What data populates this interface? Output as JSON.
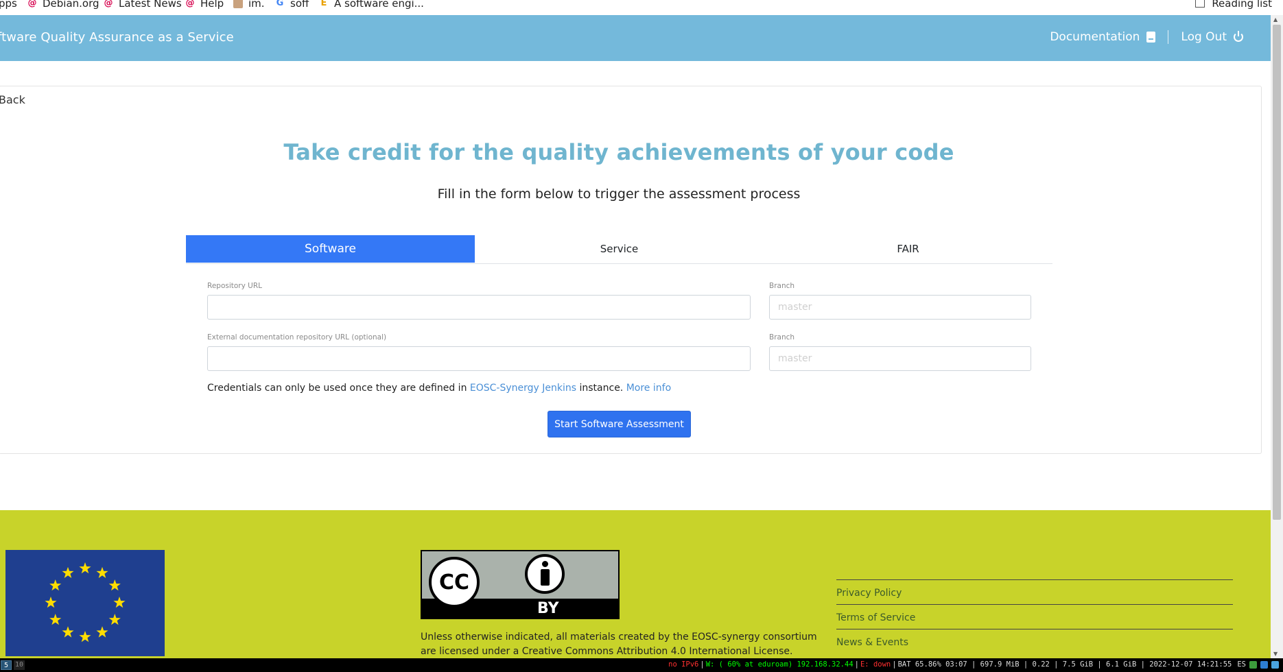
{
  "bookmarks": {
    "items": [
      {
        "label": "pps",
        "icon": ""
      },
      {
        "label": "Debian.org",
        "icon": "debian-swirl-icon"
      },
      {
        "label": "Latest News",
        "icon": "debian-swirl-icon"
      },
      {
        "label": "Help",
        "icon": "debian-swirl-icon"
      },
      {
        "label": "im.",
        "icon": "avatar-face-icon"
      },
      {
        "label": "soff",
        "icon": "google-icon"
      },
      {
        "label": "A software engi...",
        "icon": "etymology-icon"
      }
    ],
    "reading_list": "Reading list"
  },
  "header": {
    "brand": "ftware Quality Assurance as a Service",
    "documentation": "Documentation",
    "logout": "Log Out",
    "color": "#74b9db"
  },
  "main": {
    "back": "Back",
    "title": "Take credit for the quality achievements of your code",
    "subtitle": "Fill in the form below to trigger the assessment process",
    "tabs": [
      {
        "label": "Software",
        "active": true
      },
      {
        "label": "Service",
        "active": false
      },
      {
        "label": "FAIR",
        "active": false
      }
    ],
    "form": {
      "repo_label": "Repository URL",
      "repo_value": "",
      "branch_label": "Branch",
      "branch_placeholder": "master",
      "ext_label": "External documentation repository URL (optional)",
      "ext_value": "",
      "branch2_label": "Branch",
      "branch2_placeholder": "master",
      "cred_prefix": "Credentials can only be used once they are defined in ",
      "cred_link": "EOSC-Synergy Jenkins",
      "cred_middle": " instance. ",
      "cred_more": "More info",
      "start_button": "Start Software Assessment"
    },
    "accent": "#3478f6"
  },
  "footer": {
    "cc_badge_by": "BY",
    "cc_badge_cc": "CC",
    "license": "Unless otherwise indicated, all materials created by the EOSC-synergy consortium are licensed under a Creative Commons Attribution 4.0 International License.",
    "links": [
      "Privacy Policy",
      "Terms of Service",
      "News & Events"
    ],
    "color": "#c8d32a"
  },
  "statusbar": {
    "ws_active": "5",
    "ws_other": "10",
    "ipv6": "no IPv6",
    "wifi": "W: ( 60% at eduroam) 192.168.32.44",
    "eth": "E: down",
    "rest": "BAT 65.86% 03:07 | 697.9 MiB | 0.22 | 7.5 GiB | 6.1 GiB | 2022-12-07 14:21:55",
    "lang": "ES"
  }
}
